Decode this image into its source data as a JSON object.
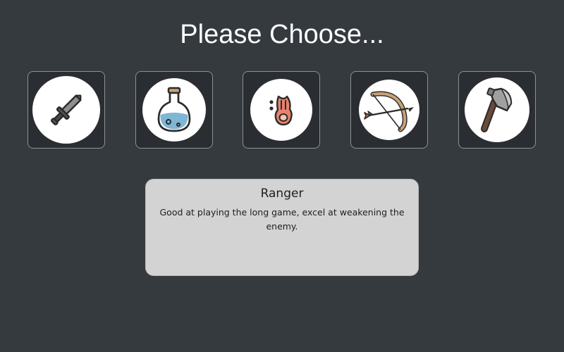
{
  "header": {
    "title": "Please Choose..."
  },
  "choices": [
    {
      "icon": "sword-icon"
    },
    {
      "icon": "potion-icon"
    },
    {
      "icon": "fireball-icon"
    },
    {
      "icon": "bow-arrow-icon"
    },
    {
      "icon": "axe-icon"
    }
  ],
  "selected": {
    "name": "Ranger",
    "description": "Good at playing the long game, excel at weakening the enemy."
  },
  "colors": {
    "background": "#353a3f",
    "tile": "#2a2d31",
    "tile_border": "#8d9195",
    "panel": "#d3d3d3"
  }
}
